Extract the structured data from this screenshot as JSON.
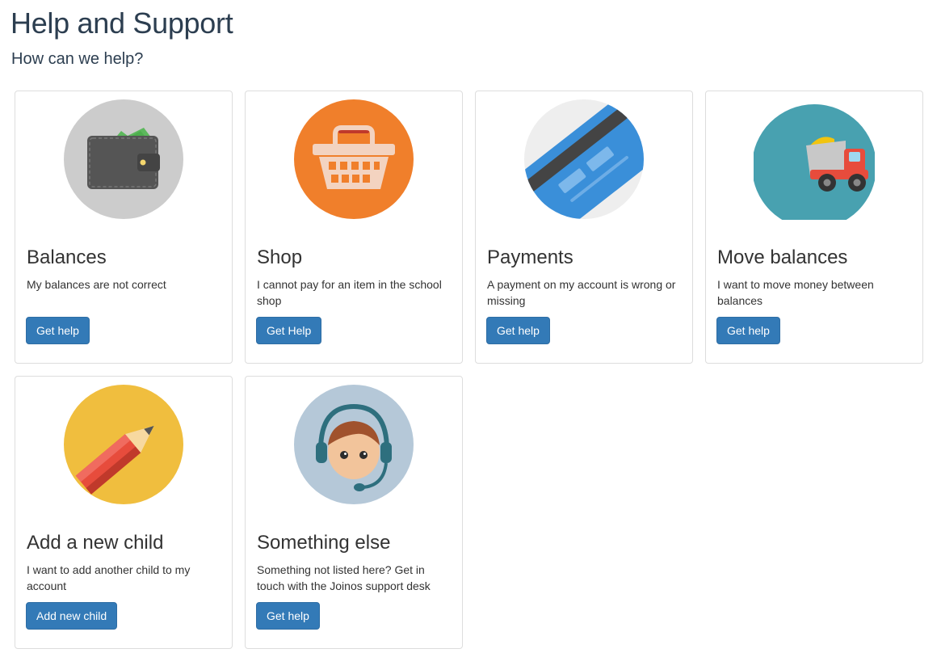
{
  "header": {
    "title": "Help and Support",
    "subtitle": "How can we help?"
  },
  "cards": [
    {
      "title": "Balances",
      "description": "My balances are not correct",
      "button": "Get help",
      "icon": "wallet-icon",
      "color": "#cccccc"
    },
    {
      "title": "Shop",
      "description": "I cannot pay for an item in the school shop",
      "button": "Get Help",
      "icon": "basket-icon",
      "color": "#f07f2b"
    },
    {
      "title": "Payments",
      "description": "A payment on my account is wrong or missing",
      "button": "Get help",
      "icon": "credit-card-icon",
      "color": "#eeeeee"
    },
    {
      "title": "Move balances",
      "description": "I want to move money between balances",
      "button": "Get help",
      "icon": "truck-icon",
      "color": "#48a1b0"
    },
    {
      "title": "Add a new child",
      "description": "I want to add another child to my account",
      "button": "Add new child",
      "icon": "pencil-icon",
      "color": "#f0be3e"
    },
    {
      "title": "Something else",
      "description": "Something not listed here? Get in touch with the Joinos support desk",
      "button": "Get help",
      "icon": "support-agent-icon",
      "color": "#b5c8d8"
    }
  ],
  "colors": {
    "primary_button": "#337ab7",
    "heading": "#2c3e50"
  }
}
